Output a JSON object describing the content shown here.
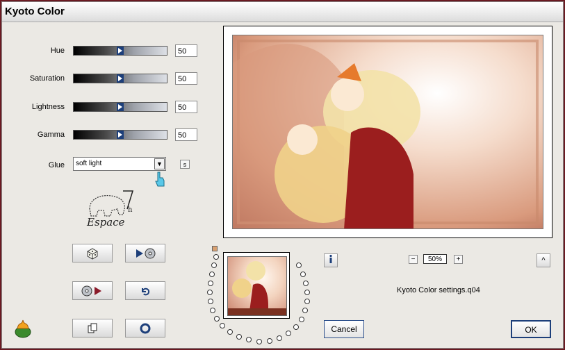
{
  "window": {
    "title": "Kyoto Color"
  },
  "controls": [
    {
      "label": "Hue",
      "value": "50",
      "level": 0.5
    },
    {
      "label": "Saturation",
      "value": "50",
      "level": 0.5
    },
    {
      "label": "Lightness",
      "value": "50",
      "level": 0.5
    },
    {
      "label": "Gamma",
      "value": "50",
      "level": 0.5
    }
  ],
  "glue": {
    "label": "Glue",
    "value": "soft light",
    "s_button": "s"
  },
  "logo": {
    "text": "Espace 7"
  },
  "preview": {
    "zoom": "50%",
    "zoom_minus": "−",
    "zoom_plus": "+",
    "up_button": "^"
  },
  "settings_file": "Kyoto Color settings.q04",
  "buttons": {
    "cancel": "Cancel",
    "ok": "OK"
  },
  "colors": {
    "accent": "#1d3f7a",
    "window_bg": "#ebe9e4",
    "frame": "#6b1a22"
  }
}
